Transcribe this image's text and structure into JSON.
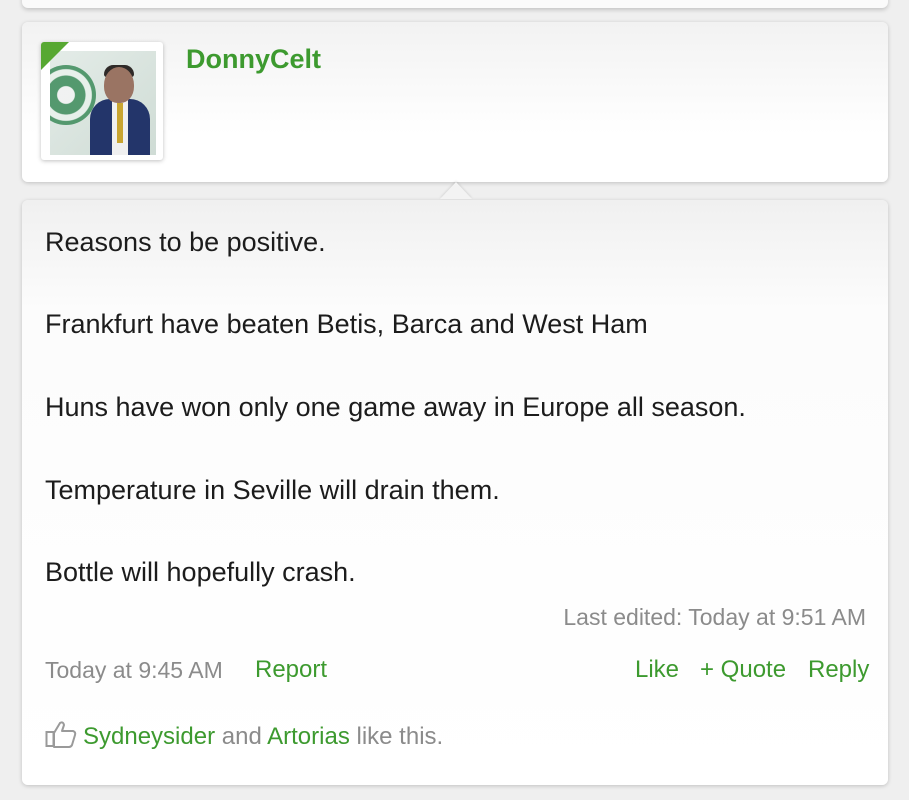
{
  "author": {
    "username": "DonnyCelt"
  },
  "message": {
    "lines": [
      "Reasons to be positive.",
      "Frankfurt have beaten Betis, Barca and West Ham",
      "Huns have won only one game away in Europe all season.",
      "Temperature in Seville will drain them.",
      "Bottle will hopefully crash."
    ],
    "last_edited": "Last edited: Today at 9:51 AM"
  },
  "meta": {
    "timestamp": "Today at 9:45 AM",
    "report": "Report",
    "like": "Like",
    "quote": "+ Quote",
    "reply": "Reply"
  },
  "likes": {
    "user1": "Sydneysider",
    "conjunction": "and",
    "user2": "Artorias",
    "suffix": "like this."
  },
  "colors": {
    "accent": "#3d9a2f",
    "muted": "#8b8b8b",
    "text": "#1c1c1c"
  },
  "icons": [
    "thumbs-up-icon"
  ]
}
